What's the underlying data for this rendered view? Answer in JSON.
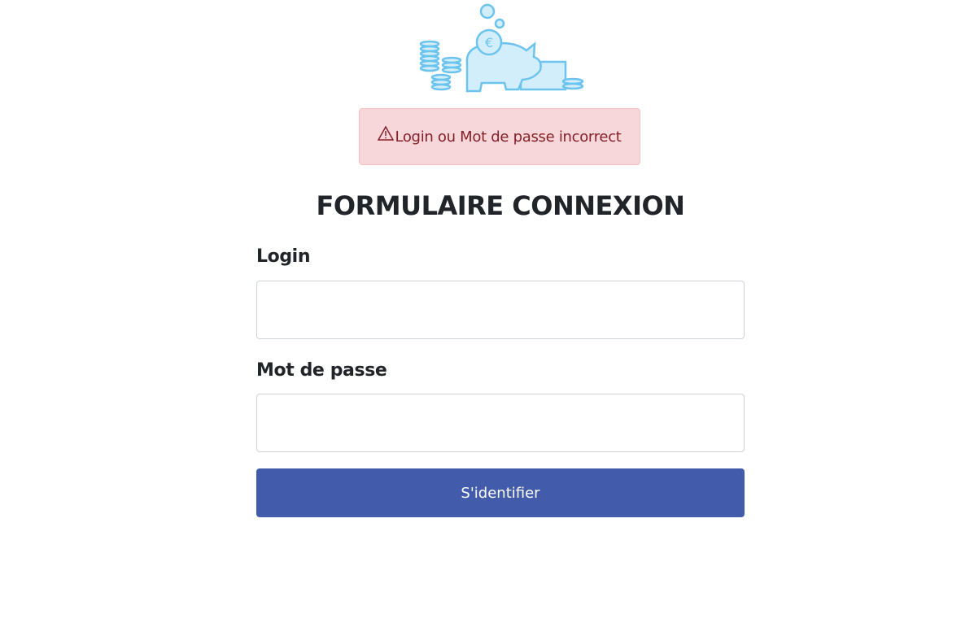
{
  "logo": {
    "icon": "piggy-bank-euro-coins",
    "color": "#6cc4ee"
  },
  "alert": {
    "icon": "warning-triangle-icon",
    "message": "Login ou Mot de passe incorrect",
    "color": "#842029"
  },
  "form": {
    "title": "FORMULAIRE CONNEXION",
    "login_label": "Login",
    "login_value": "",
    "password_label": "Mot de passe",
    "password_value": "",
    "submit_label": "S'identifier",
    "accent": "#425cab"
  }
}
